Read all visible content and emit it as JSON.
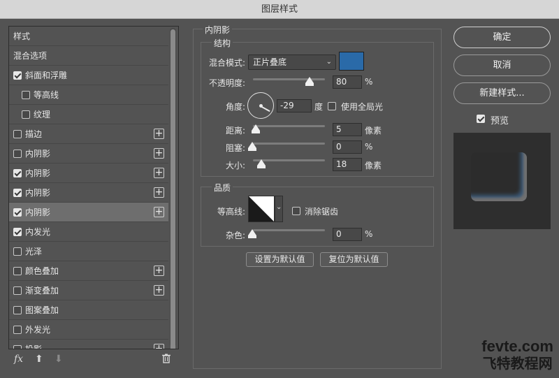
{
  "window_title": "图层样式",
  "style_list": {
    "items": [
      {
        "label": "样式",
        "type": "header"
      },
      {
        "label": "混合选项",
        "type": "header"
      },
      {
        "label": "斜面和浮雕",
        "checked": true,
        "plus": false
      },
      {
        "label": "等高线",
        "checked": false,
        "sub": true
      },
      {
        "label": "纹理",
        "checked": false,
        "sub": true
      },
      {
        "label": "描边",
        "checked": false,
        "plus": true
      },
      {
        "label": "内阴影",
        "checked": false,
        "plus": true
      },
      {
        "label": "内阴影",
        "checked": true,
        "plus": true
      },
      {
        "label": "内阴影",
        "checked": true,
        "plus": true
      },
      {
        "label": "内阴影",
        "checked": true,
        "plus": true,
        "selected": true
      },
      {
        "label": "内发光",
        "checked": true,
        "plus": false
      },
      {
        "label": "光泽",
        "checked": false,
        "plus": false
      },
      {
        "label": "颜色叠加",
        "checked": false,
        "plus": true
      },
      {
        "label": "渐变叠加",
        "checked": false,
        "plus": true
      },
      {
        "label": "图案叠加",
        "checked": false,
        "plus": false
      },
      {
        "label": "外发光",
        "checked": false,
        "plus": false
      },
      {
        "label": "投影",
        "checked": false,
        "plus": true
      }
    ],
    "bottom_icons": {
      "fx": "fx",
      "up": "⬆",
      "down": "⬇",
      "trash": "🗑"
    }
  },
  "inner_shadow": {
    "section_title": "内阴影",
    "structure_title": "结构",
    "blend_mode_label": "混合模式:",
    "blend_mode_value": "正片叠底",
    "color": "#2a6aa8",
    "opacity_label": "不透明度:",
    "opacity_value": "80",
    "opacity_unit": "%",
    "angle_label": "角度:",
    "angle_value": "-29",
    "angle_unit": "度",
    "global_light_label": "使用全局光",
    "distance_label": "距离:",
    "distance_value": "5",
    "distance_unit": "像素",
    "choke_label": "阻塞:",
    "choke_value": "0",
    "choke_unit": "%",
    "size_label": "大小:",
    "size_value": "18",
    "size_unit": "像素",
    "quality_title": "品质",
    "contour_label": "等高线:",
    "antialias_label": "消除锯齿",
    "noise_label": "杂色:",
    "noise_value": "0",
    "noise_unit": "%",
    "set_default_label": "设置为默认值",
    "reset_default_label": "复位为默认值"
  },
  "right_panel": {
    "ok_label": "确定",
    "cancel_label": "取消",
    "new_style_label": "新建样式...",
    "preview_label": "预览"
  },
  "watermark": {
    "line1": "fevte.com",
    "line2": "飞特教程网"
  }
}
